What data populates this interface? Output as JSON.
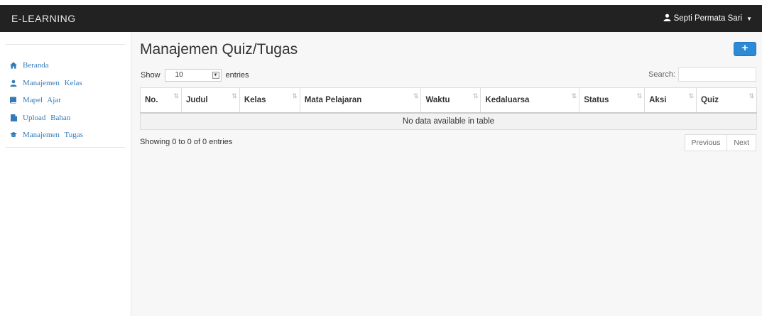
{
  "navbar": {
    "brand_prefix": "E",
    "brand_sep": "-",
    "brand_rest": "LEARNING",
    "user_name": "Septi Permata Sari"
  },
  "sidebar": {
    "items": [
      {
        "label": "Beranda",
        "icon": "home-icon"
      },
      {
        "label": "Manajemen Kelas",
        "icon": "user-icon"
      },
      {
        "label": "Mapel Ajar",
        "icon": "book-icon"
      },
      {
        "label": "Upload Bahan",
        "icon": "file-icon"
      },
      {
        "label": "Manajemen Tugas",
        "icon": "graduation-cap-icon"
      }
    ]
  },
  "main": {
    "title": "Manajemen Quiz/Tugas",
    "add_label": "+",
    "length_show": "Show",
    "length_value": "10",
    "length_entries": "entries",
    "search_label": "Search:",
    "columns": [
      "No.",
      "Judul",
      "Kelas",
      "Mata Pelajaran",
      "Waktu",
      "Kedaluarsa",
      "Status",
      "Aksi",
      "Quiz"
    ],
    "empty_text": "No data available in table",
    "info": "Showing 0 to 0 of 0 entries",
    "prev_label": "Previous",
    "next_label": "Next"
  },
  "colors": {
    "navbar_bg": "#222222",
    "accent": "#2d8ad6",
    "link": "#337ab7"
  }
}
